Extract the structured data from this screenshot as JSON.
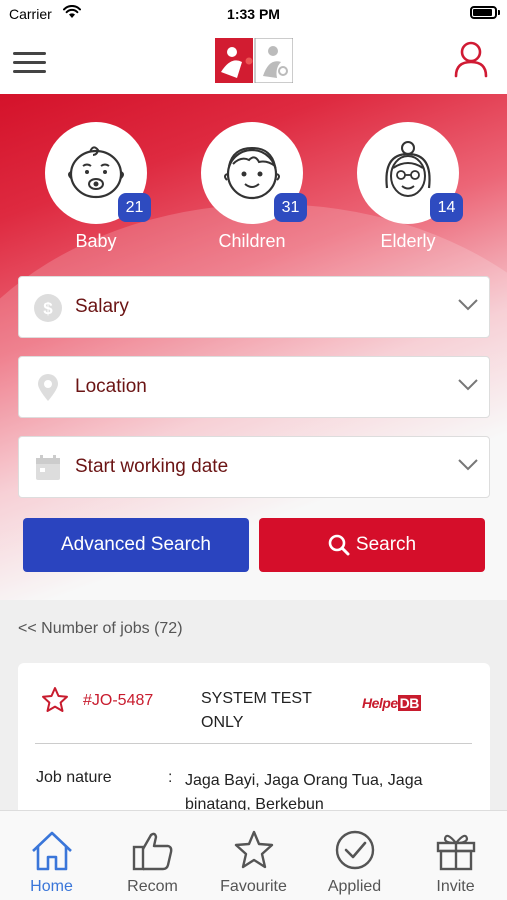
{
  "status_bar": {
    "carrier": "Carrier",
    "time": "1:33 PM"
  },
  "header": {
    "menu_icon": "hamburger-menu-icon",
    "logo_icon": "helper-logo",
    "profile_icon": "user-profile-icon"
  },
  "categories": [
    {
      "label": "Baby",
      "count": "21",
      "icon": "baby-face-icon"
    },
    {
      "label": "Children",
      "count": "31",
      "icon": "child-face-icon"
    },
    {
      "label": "Elderly",
      "count": "14",
      "icon": "elderly-face-icon"
    }
  ],
  "filters": {
    "salary": {
      "label": "Salary",
      "icon": "dollar-coin-icon"
    },
    "location": {
      "label": "Location",
      "icon": "map-pin-icon"
    },
    "start_date": {
      "label": "Start working date",
      "icon": "calendar-icon"
    }
  },
  "buttons": {
    "advanced_search": "Advanced Search",
    "search": "Search"
  },
  "job_count": "<< Number of jobs (72)",
  "job": {
    "id": "#JO-5487",
    "title": "SYSTEM TEST ONLY",
    "agency_logo_text": "Helpe",
    "agency_logo_box": "DB",
    "nature_label": "Job nature",
    "nature_colon": ":",
    "nature_value": "Jaga Bayi, Jaga Orang Tua, Jaga binatang, Berkebun"
  },
  "tabs": [
    {
      "label": "Home",
      "icon": "home-icon",
      "active": true
    },
    {
      "label": "Recom",
      "icon": "thumbs-up-icon",
      "active": false
    },
    {
      "label": "Favourite",
      "icon": "star-icon",
      "active": false
    },
    {
      "label": "Applied",
      "icon": "check-circle-icon",
      "active": false
    },
    {
      "label": "Invite",
      "icon": "gift-icon",
      "active": false
    }
  ],
  "colors": {
    "brand_red": "#d50e2a",
    "brand_blue": "#2a44bf",
    "tab_active": "#3a76d9"
  }
}
